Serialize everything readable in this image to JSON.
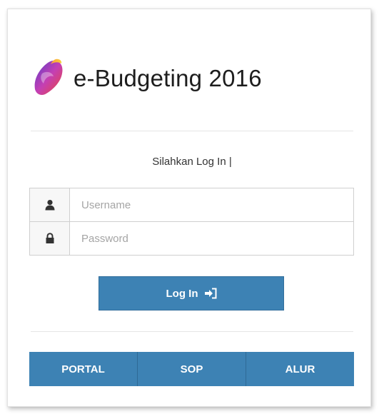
{
  "app": {
    "title": "e-Budgeting 2016"
  },
  "login": {
    "prompt": "Silahkan Log In |",
    "username_placeholder": "Username",
    "password_placeholder": "Password",
    "button_label": "Log In",
    "button_icon": "sign-in-icon"
  },
  "nav": {
    "items": [
      {
        "label": "PORTAL"
      },
      {
        "label": "SOP"
      },
      {
        "label": "ALUR"
      }
    ]
  },
  "colors": {
    "primary": "#3d82b4",
    "text": "#1d1d1d",
    "placeholder": "#a5a5a5"
  }
}
